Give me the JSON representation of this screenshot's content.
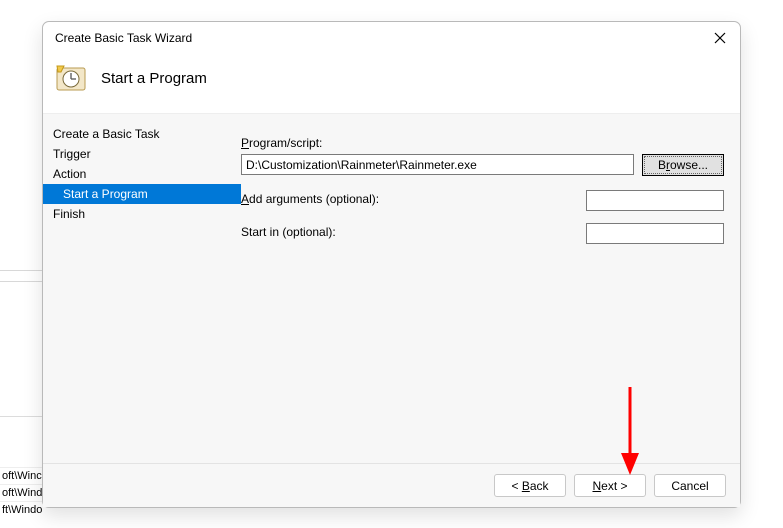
{
  "dialog_title": "Create Basic Task Wizard",
  "page_heading": "Start a Program",
  "sidebar": {
    "steps": [
      {
        "label": "Create a Basic Task",
        "sub": false,
        "selected": false
      },
      {
        "label": "Trigger",
        "sub": false,
        "selected": false
      },
      {
        "label": "Action",
        "sub": false,
        "selected": false
      },
      {
        "label": "Start a Program",
        "sub": true,
        "selected": true
      },
      {
        "label": "Finish",
        "sub": false,
        "selected": false
      }
    ]
  },
  "form": {
    "program_label": "Program/script:",
    "program_value": "D:\\Customization\\Rainmeter\\Rainmeter.exe",
    "browse_label": "Browse...",
    "args_label": "Add arguments (optional):",
    "args_value": "",
    "startin_label": "Start in (optional):",
    "startin_value": ""
  },
  "buttons": {
    "back": "< Back",
    "next": "Next >",
    "cancel": "Cancel"
  },
  "bg": {
    "line1": "oft\\Winc",
    "line2": "oft\\Windows\\U...",
    "line3": "ft\\Windows\\Fi"
  }
}
